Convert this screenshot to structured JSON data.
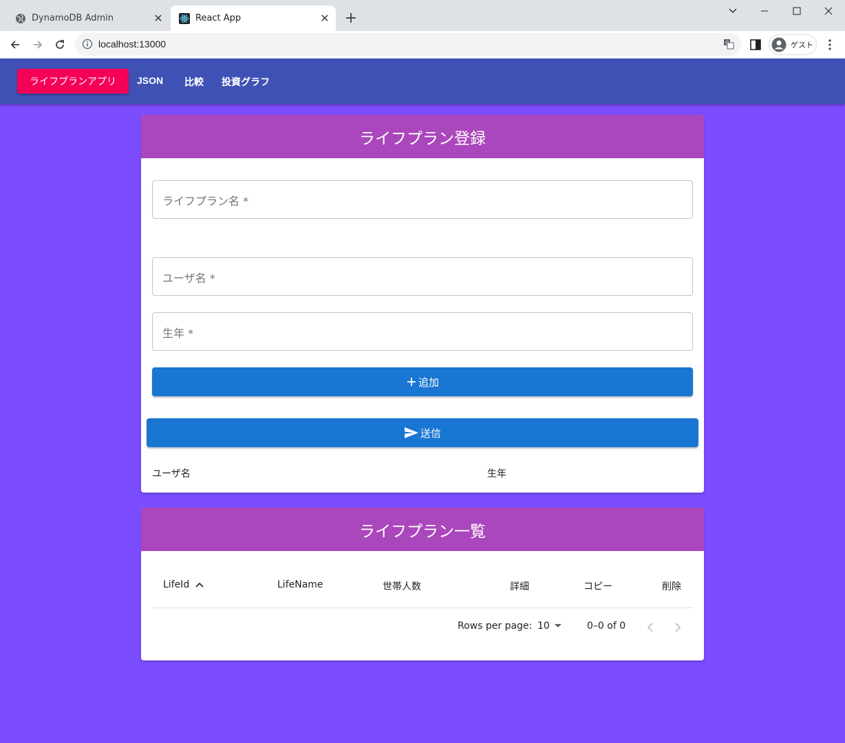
{
  "browser": {
    "tabs": [
      {
        "title": "DynamoDB Admin",
        "icon": "globe-icon",
        "active": false
      },
      {
        "title": "React App",
        "icon": "react-icon",
        "active": true
      }
    ],
    "url": "localhost:13000",
    "profile_label": "ゲスト"
  },
  "appbar": {
    "brand": "ライフプランアプリ",
    "links": [
      "JSON",
      "比較",
      "投資グラフ"
    ],
    "color": "#3f51b5",
    "brand_color": "#f50057"
  },
  "register": {
    "title": "ライフプラン登録",
    "fields": {
      "plan_name": "ライフプラン名 *",
      "user_name": "ユーザ名 *",
      "birth_year": "生年 *"
    },
    "add_label": "追加",
    "submit_label": "送信",
    "columns": [
      "ユーザ名",
      "生年"
    ]
  },
  "list": {
    "title": "ライフプラン一覧",
    "columns": [
      "LifeId",
      "LifeName",
      "世帯人数",
      "詳細",
      "コピー",
      "削除"
    ],
    "rows": [],
    "rows_per_page_label": "Rows per page:",
    "rows_per_page": "10",
    "range": "0–0 of 0"
  },
  "colors": {
    "background": "#7c4dff",
    "card_header": "#ab47bc",
    "primary": "#1976d2"
  }
}
